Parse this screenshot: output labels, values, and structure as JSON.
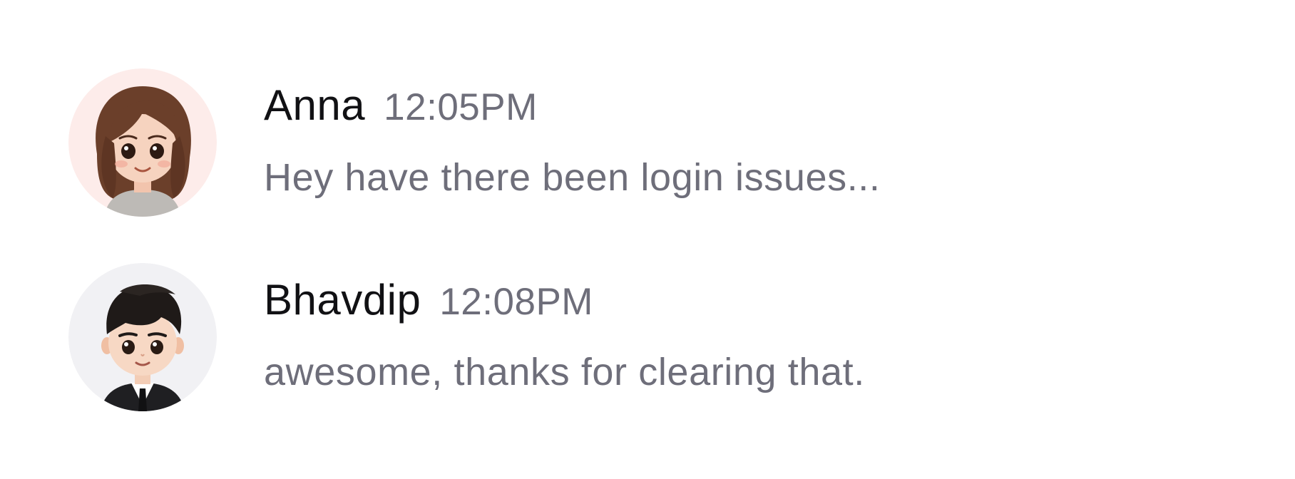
{
  "messages": [
    {
      "sender": "Anna",
      "time": "12:05PM",
      "text": "Hey have there been login issues...",
      "avatar": {
        "description": "cartoon-girl-avatar",
        "background_color": "#fdecea"
      }
    },
    {
      "sender": "Bhavdip",
      "time": "12:08PM",
      "text": "awesome, thanks for clearing that.",
      "avatar": {
        "description": "cartoon-boy-avatar",
        "background_color": "#f1f1f4"
      }
    }
  ],
  "colors": {
    "sender_name": "#111114",
    "secondary_text": "#6e6e7a",
    "page_background": "#ffffff"
  }
}
